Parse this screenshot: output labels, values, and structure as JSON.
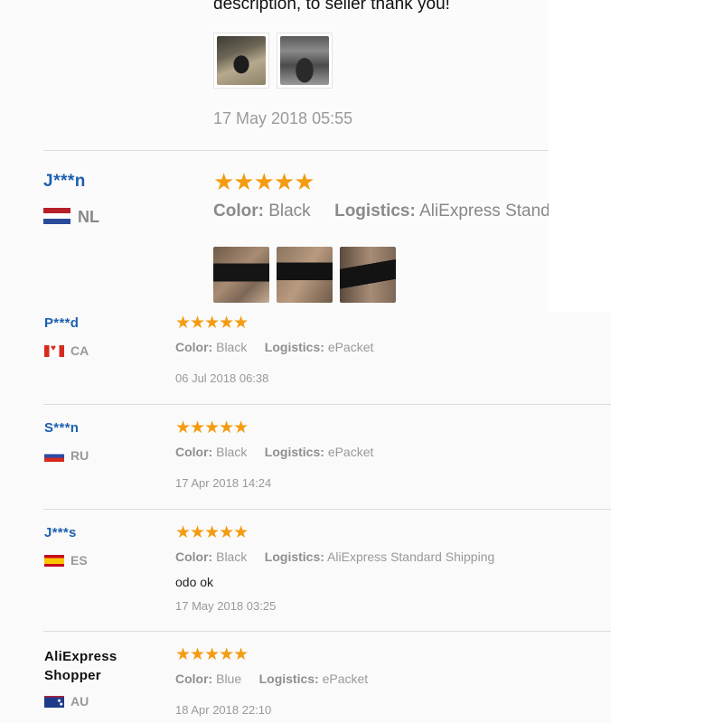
{
  "top_review": {
    "description_tail": "description, to seller thank you!",
    "date": "17 May 2018 05:55",
    "photos": [
      "watch-photo",
      "box-photo"
    ]
  },
  "featured_review": {
    "name": "J***n",
    "country": "NL",
    "rating": 5,
    "stars": "★★★★★",
    "color_label": "Color:",
    "color_value": "Black",
    "logistics_label": "Logistics:",
    "logistics_value": "AliExpress Standard Shipping",
    "photos": [
      "wrist-photo-1",
      "wrist-photo-2",
      "wrist-photo-3"
    ]
  },
  "reviews": [
    {
      "name": "P***d",
      "country": "CA",
      "rating": 5,
      "stars": "★★★★★",
      "color_label": "Color:",
      "color_value": "Black",
      "logistics_label": "Logistics:",
      "logistics_value": "ePacket",
      "text": "",
      "date": "06 Jul 2018 06:38"
    },
    {
      "name": "S***n",
      "country": "RU",
      "rating": 5,
      "stars": "★★★★★",
      "color_label": "Color:",
      "color_value": "Black",
      "logistics_label": "Logistics:",
      "logistics_value": "ePacket",
      "text": "",
      "date": "17 Apr 2018 14:24"
    },
    {
      "name": "J***s",
      "country": "ES",
      "rating": 5,
      "stars": "★★★★★",
      "color_label": "Color:",
      "color_value": "Black",
      "logistics_label": "Logistics:",
      "logistics_value": "AliExpress Standard Shipping",
      "text": "odo ok",
      "date": "17 May 2018 03:25"
    },
    {
      "name": "AliExpress Shopper",
      "country": "AU",
      "rating": 5,
      "stars": "★★★★★",
      "color_label": "Color:",
      "color_value": "Blue",
      "logistics_label": "Logistics:",
      "logistics_value": "ePacket",
      "text": "",
      "date": "18 Apr 2018 22:10"
    }
  ],
  "colors": {
    "name_link": "#1d5fb0",
    "star": "#f39c12",
    "meta": "#999999"
  }
}
